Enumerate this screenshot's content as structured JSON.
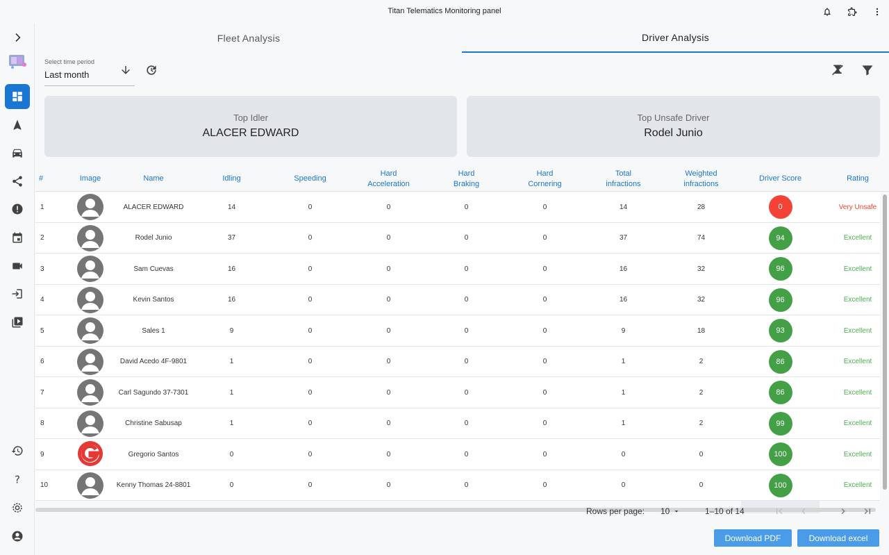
{
  "window": {
    "title": "Titan Telematics Monitoring panel"
  },
  "tabs": [
    {
      "label": "Fleet Analysis"
    },
    {
      "label": "Driver Analysis"
    }
  ],
  "period": {
    "label": "Select time period",
    "value": "Last month"
  },
  "cards": {
    "top_idler": {
      "title": "Top Idler",
      "value": "ALACER EDWARD"
    },
    "top_unsafe": {
      "title": "Top Unsafe Driver",
      "value": "Rodel Junio"
    }
  },
  "table": {
    "headers": [
      "#",
      "Image",
      "Name",
      "Idling",
      "Speeding",
      "Hard\nAcceleration",
      "Hard\nBraking",
      "Hard\nCornering",
      "Total\ninfractions",
      "Weighted\ninfractions",
      "Driver Score",
      "Rating"
    ],
    "rows": [
      {
        "n": "1",
        "name": "ALACER EDWARD",
        "idling": "14",
        "speeding": "0",
        "accel": "0",
        "braking": "0",
        "cornering": "0",
        "total": "14",
        "weighted": "28",
        "score": "0",
        "rating": "Very Unsafe",
        "avatar": "default"
      },
      {
        "n": "2",
        "name": "Rodel Junio",
        "idling": "37",
        "speeding": "0",
        "accel": "0",
        "braking": "0",
        "cornering": "0",
        "total": "37",
        "weighted": "74",
        "score": "94",
        "rating": "Excellent",
        "avatar": "default"
      },
      {
        "n": "3",
        "name": "Sam Cuevas",
        "idling": "16",
        "speeding": "0",
        "accel": "0",
        "braking": "0",
        "cornering": "0",
        "total": "16",
        "weighted": "32",
        "score": "96",
        "rating": "Excellent",
        "avatar": "default"
      },
      {
        "n": "4",
        "name": "Kevin Santos",
        "idling": "16",
        "speeding": "0",
        "accel": "0",
        "braking": "0",
        "cornering": "0",
        "total": "16",
        "weighted": "32",
        "score": "96",
        "rating": "Excellent",
        "avatar": "default"
      },
      {
        "n": "5",
        "name": "Sales 1",
        "idling": "9",
        "speeding": "0",
        "accel": "0",
        "braking": "0",
        "cornering": "0",
        "total": "9",
        "weighted": "18",
        "score": "93",
        "rating": "Excellent",
        "avatar": "default"
      },
      {
        "n": "6",
        "name": "David Acedo 4F-9801",
        "idling": "1",
        "speeding": "0",
        "accel": "0",
        "braking": "0",
        "cornering": "0",
        "total": "1",
        "weighted": "2",
        "score": "86",
        "rating": "Excellent",
        "avatar": "default"
      },
      {
        "n": "7",
        "name": "Carl Sagundo 37-7301",
        "idling": "1",
        "speeding": "0",
        "accel": "0",
        "braking": "0",
        "cornering": "0",
        "total": "1",
        "weighted": "2",
        "score": "86",
        "rating": "Excellent",
        "avatar": "default"
      },
      {
        "n": "8",
        "name": "Christine Sabusap",
        "idling": "1",
        "speeding": "0",
        "accel": "0",
        "braking": "0",
        "cornering": "0",
        "total": "1",
        "weighted": "2",
        "score": "99",
        "rating": "Excellent",
        "avatar": "default"
      },
      {
        "n": "9",
        "name": "Gregorio Santos",
        "idling": "0",
        "speeding": "0",
        "accel": "0",
        "braking": "0",
        "cornering": "0",
        "total": "0",
        "weighted": "0",
        "score": "100",
        "rating": "Excellent",
        "avatar": "logo"
      },
      {
        "n": "10",
        "name": "Kenny Thomas 24-8801",
        "idling": "0",
        "speeding": "0",
        "accel": "0",
        "braking": "0",
        "cornering": "0",
        "total": "0",
        "weighted": "0",
        "score": "100",
        "rating": "Excellent",
        "avatar": "default"
      }
    ]
  },
  "pagination": {
    "rows_label": "Rows per page:",
    "rows_value": "10",
    "range": "1–10 of 14"
  },
  "buttons": {
    "pdf": "Download PDF",
    "excel": "Download excel"
  },
  "colors": {
    "accent": "#1976d2",
    "score_good": "#43a047",
    "score_bad": "#f44336",
    "rating_good": "#4caf50",
    "rating_bad": "#f44336"
  },
  "icons": {
    "titlebar": [
      "bell-icon",
      "extension-icon",
      "more-vert-icon"
    ],
    "sidebar_top": [
      "chevron-right-icon",
      "logo-icon",
      "dashboard-icon",
      "navigation-icon",
      "car-icon",
      "share-icon",
      "alert-icon",
      "calendar-icon",
      "video-camera-icon",
      "login-icon",
      "playlist-play-icon"
    ],
    "sidebar_bottom": [
      "history-icon",
      "help-icon",
      "settings-icon",
      "account-icon"
    ]
  }
}
